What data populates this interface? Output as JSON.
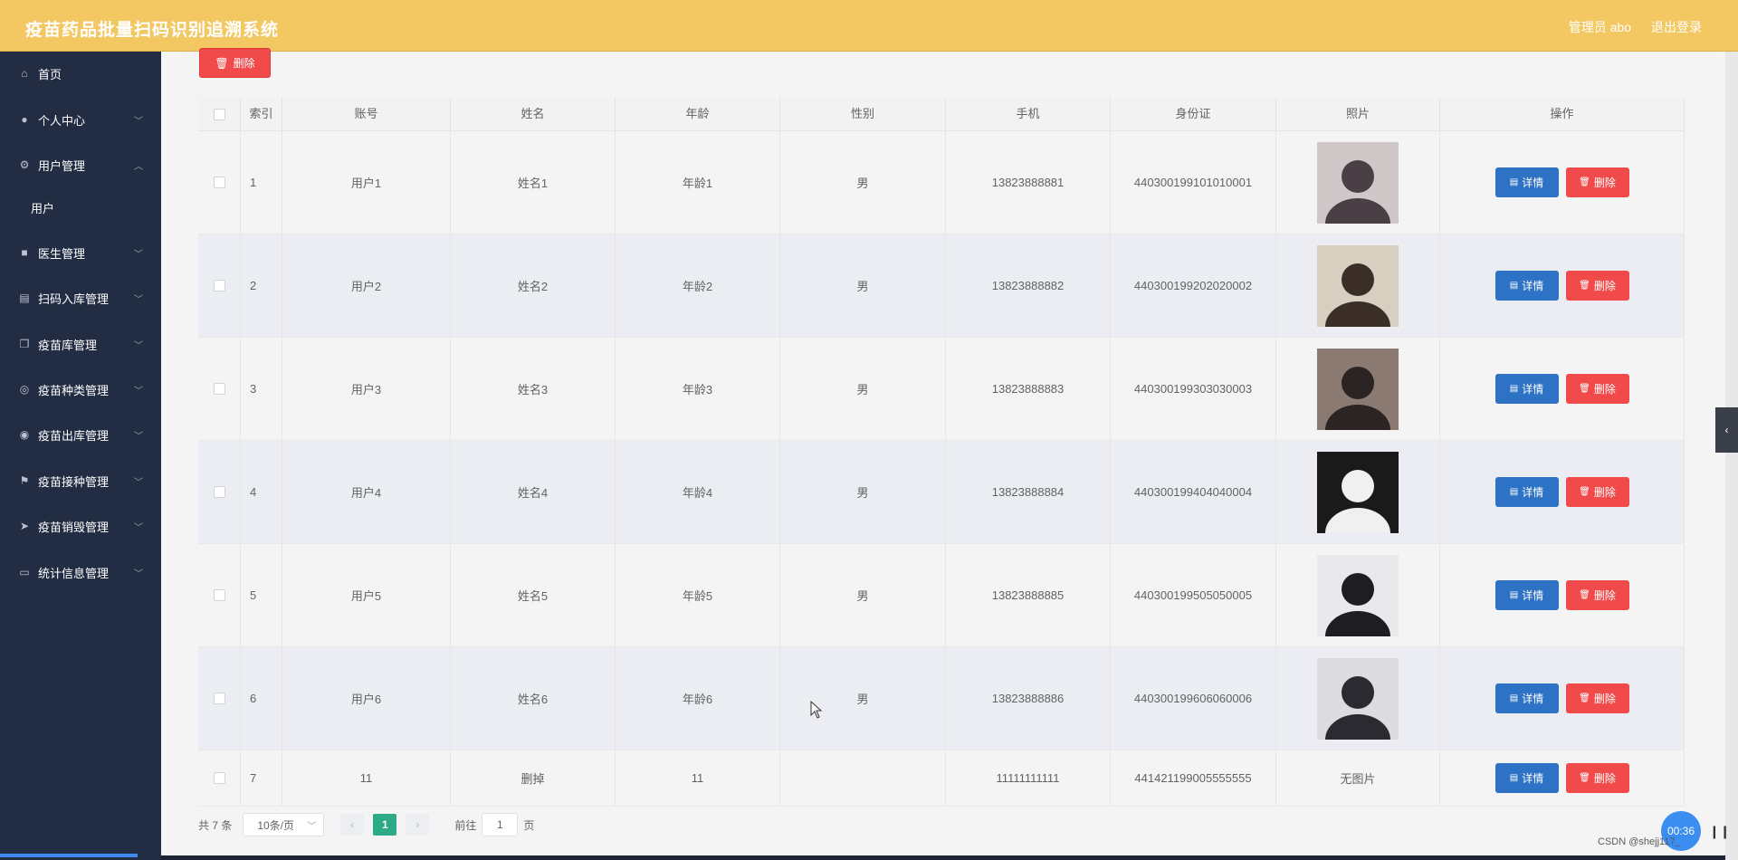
{
  "header": {
    "title": "疫苗药品批量扫码识别追溯系统",
    "admin_label": "管理员 abo",
    "logout_label": "退出登录"
  },
  "sidebar": {
    "items": [
      {
        "label": "首页",
        "icon": "home-icon",
        "glyph": "⌂"
      },
      {
        "label": "个人中心",
        "icon": "user-icon",
        "glyph": "●"
      },
      {
        "label": "用户管理",
        "icon": "gear-icon",
        "glyph": "⚙"
      },
      {
        "label": "医生管理",
        "icon": "briefcase-icon",
        "glyph": "■"
      },
      {
        "label": "扫码入库管理",
        "icon": "clipboard-icon",
        "glyph": "▤"
      },
      {
        "label": "疫苗库管理",
        "icon": "copy-icon",
        "glyph": "❐"
      },
      {
        "label": "疫苗种类管理",
        "icon": "circle-icon",
        "glyph": "◎"
      },
      {
        "label": "疫苗出库管理",
        "icon": "compass-icon",
        "glyph": "◉"
      },
      {
        "label": "疫苗接种管理",
        "icon": "flag-icon",
        "glyph": "⚑"
      },
      {
        "label": "疫苗销毁管理",
        "icon": "send-icon",
        "glyph": "➤"
      },
      {
        "label": "统计信息管理",
        "icon": "chat-icon",
        "glyph": "▭"
      }
    ],
    "sub_item": "用户"
  },
  "toolbar": {
    "delete_label": "删除"
  },
  "table": {
    "headers": [
      "索引",
      "账号",
      "姓名",
      "年龄",
      "性别",
      "手机",
      "身份证",
      "照片",
      "操作"
    ],
    "rows": [
      {
        "index": "1",
        "account": "用户1",
        "name": "姓名1",
        "age": "年龄1",
        "gender": "男",
        "phone": "13823888881",
        "id_card": "440300199101010001"
      },
      {
        "index": "2",
        "account": "用户2",
        "name": "姓名2",
        "age": "年龄2",
        "gender": "男",
        "phone": "13823888882",
        "id_card": "440300199202020002"
      },
      {
        "index": "3",
        "account": "用户3",
        "name": "姓名3",
        "age": "年龄3",
        "gender": "男",
        "phone": "13823888883",
        "id_card": "440300199303030003"
      },
      {
        "index": "4",
        "account": "用户4",
        "name": "姓名4",
        "age": "年龄4",
        "gender": "男",
        "phone": "13823888884",
        "id_card": "440300199404040004"
      },
      {
        "index": "5",
        "account": "用户5",
        "name": "姓名5",
        "age": "年龄5",
        "gender": "男",
        "phone": "13823888885",
        "id_card": "440300199505050005"
      },
      {
        "index": "6",
        "account": "用户6",
        "name": "姓名6",
        "age": "年龄6",
        "gender": "男",
        "phone": "13823888886",
        "id_card": "440300199606060006"
      },
      {
        "index": "7",
        "account": "11",
        "name": "删掉",
        "age": "11",
        "gender": "",
        "phone": "11111111111",
        "id_card": "441421199005555555",
        "no_photo": "无图片"
      }
    ],
    "detail_label": "详情",
    "delete_label": "删除"
  },
  "pagination": {
    "total": "共 7 条",
    "page_size": "10条/页",
    "current_page": "1",
    "goto_label": "前往",
    "goto_value": "1",
    "page_unit": "页"
  },
  "overlay": {
    "timer": "00:36",
    "watermark": "CSDN @shejj117_"
  }
}
